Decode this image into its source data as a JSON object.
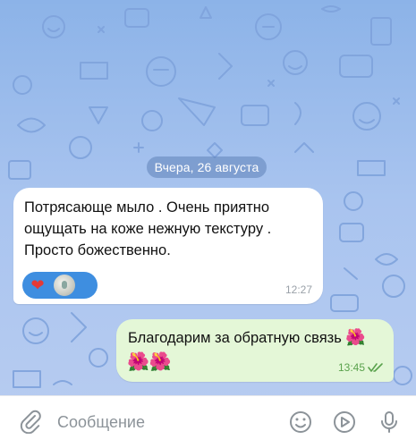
{
  "chat": {
    "date_label": "Вчера, 26 августа",
    "incoming": {
      "text": "Потрясающе мыло . Очень приятно ощущать на коже нежную текстуру . Просто божественно.",
      "time": "12:27",
      "reactions": [
        "heart",
        "face-emoji"
      ]
    },
    "outgoing": {
      "text": "Благодарим за обратную связь",
      "emoji_inline": "🌺",
      "emoji_line": "🌺🌺",
      "time": "13:45",
      "status": "read"
    }
  },
  "input": {
    "placeholder": "Сообщение",
    "icons": [
      "paperclip-icon",
      "emoji-icon",
      "video-message-icon",
      "microphone-icon"
    ]
  },
  "colors": {
    "wallpaper": "#a9c4ef",
    "incoming_bubble": "#ffffff",
    "outgoing_bubble": "#e4f7d7",
    "reaction_pill": "#3e8ee0",
    "read_check": "#5aa24d"
  }
}
